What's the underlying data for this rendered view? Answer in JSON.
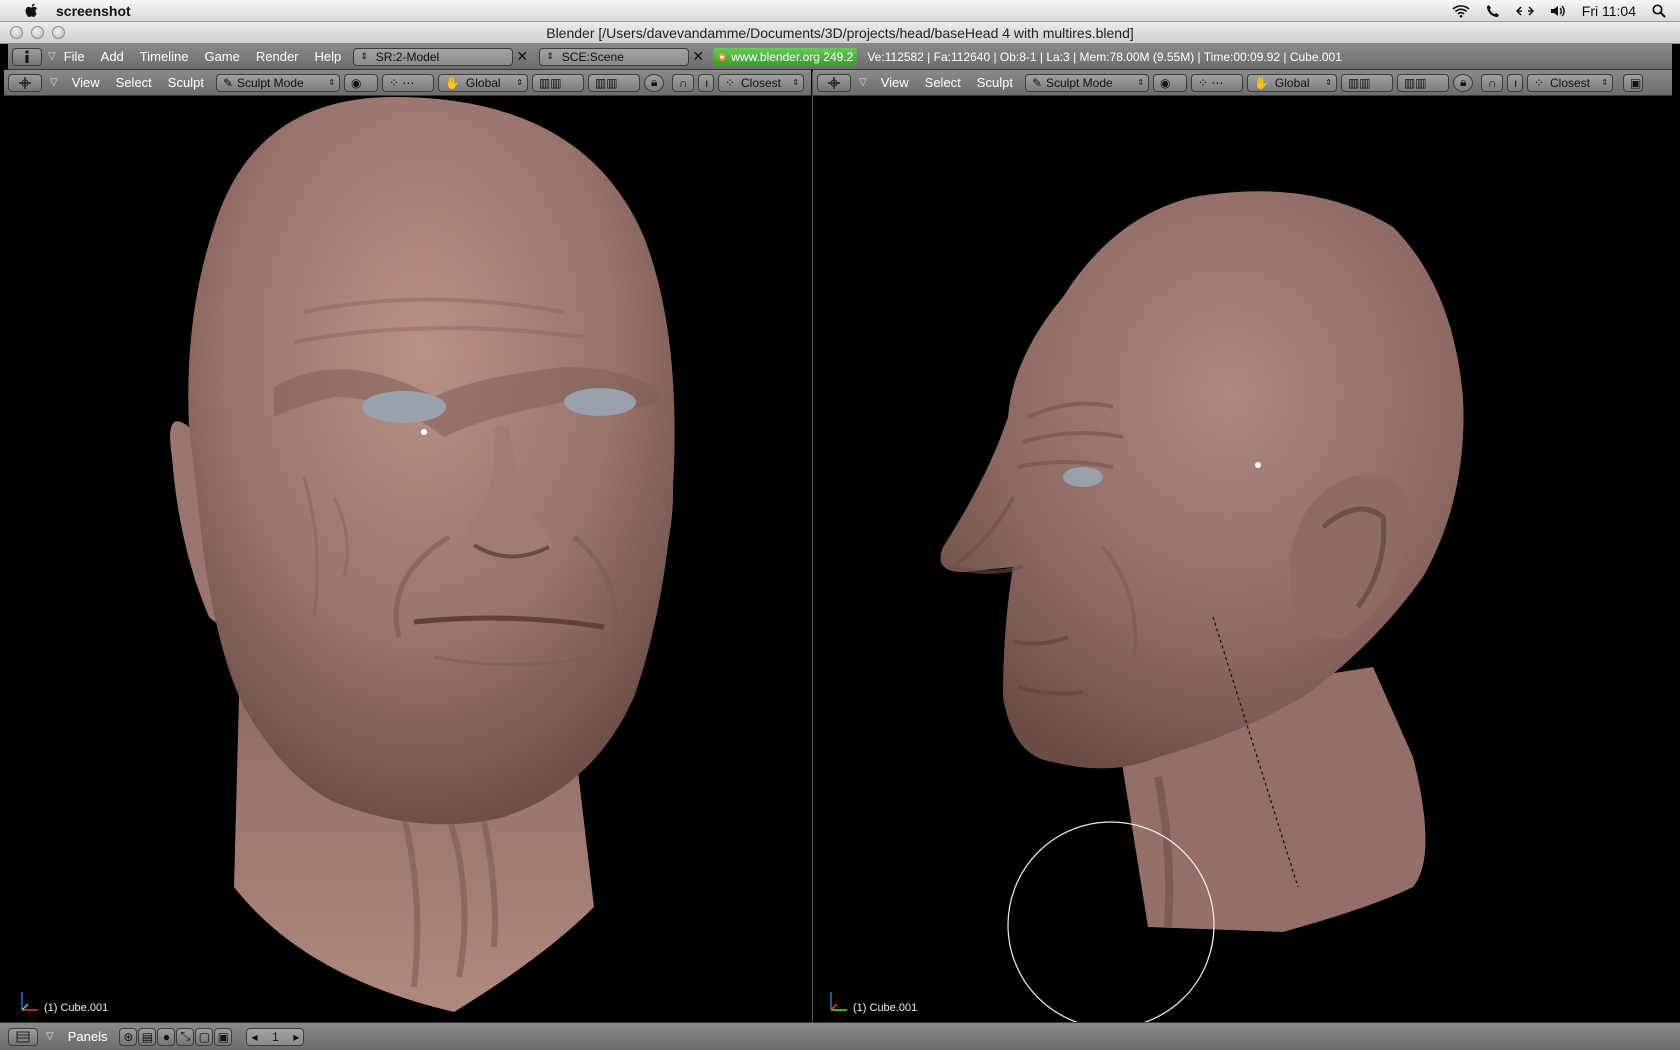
{
  "mac_menubar": {
    "app_name": "screenshot",
    "clock": "Fri 11:04"
  },
  "window": {
    "title": "Blender [/Users/davevandamme/Documents/3D/projects/head/baseHead 4 with multires.blend]"
  },
  "info_header": {
    "menus": [
      "File",
      "Add",
      "Timeline",
      "Game",
      "Render",
      "Help"
    ],
    "screen_field": "SR:2-Model",
    "scene_field": "SCE:Scene",
    "version_badge": "www.blender.org 249.2",
    "stats": "Ve:112582 | Fa:112640 | Ob:8-1 | La:3  | Mem:78.00M (9.55M)  | Time:00:09.92 | Cube.001"
  },
  "viewport_header": {
    "menus": [
      "View",
      "Select",
      "Sculpt"
    ],
    "mode": "Sculpt Mode",
    "orientation": "Global",
    "snap": "Closest"
  },
  "viewports": [
    {
      "label": "(1) Cube.001"
    },
    {
      "label": "(1) Cube.001"
    }
  ],
  "buttons_header": {
    "panels_label": "Panels",
    "frame": "1"
  },
  "colors": {
    "header_bg": "#7a7a7a",
    "viewport_bg": "#000000",
    "skin": "#9c7a72",
    "accent_green": "#4caf3f"
  }
}
